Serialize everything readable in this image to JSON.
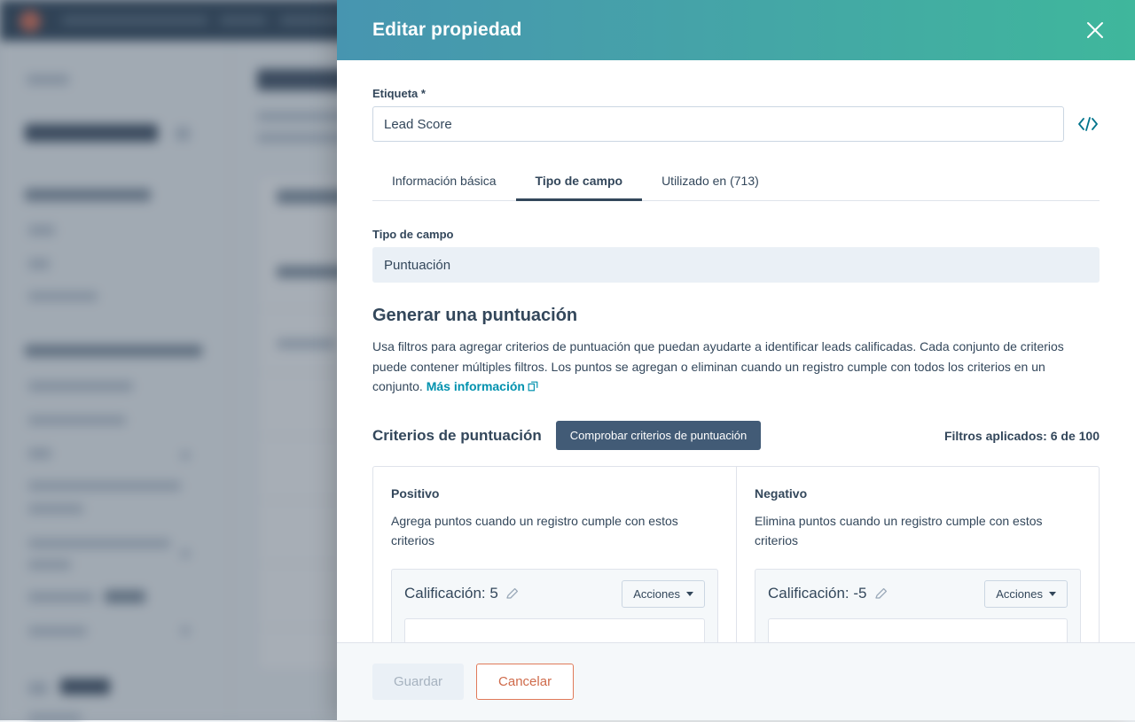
{
  "modal": {
    "title": "Editar propiedad",
    "close_icon": "close-icon",
    "label_field": {
      "label": "Etiqueta *",
      "value": "Lead Score",
      "placeholder": "Etiqueta",
      "code_icon": "code-brackets-icon"
    },
    "tabs": [
      {
        "label": "Información básica",
        "active": false
      },
      {
        "label": "Tipo de campo",
        "active": true
      },
      {
        "label": "Utilizado en (713)",
        "active": false
      }
    ],
    "field_type": {
      "label": "Tipo de campo",
      "value": "Puntuación"
    },
    "score_section": {
      "heading": "Generar una puntuación",
      "description": "Usa filtros para agregar criterios de puntuación que puedan ayudarte a identificar leads calificadas. Cada conjunto de criterios puede contener múltiples filtros. Los puntos se agregan o eliminan cuando un registro cumple con todos los criterios en un conjunto.",
      "link_text": "Más información",
      "link_icon": "external-link-icon"
    },
    "criteria": {
      "heading": "Criterios de puntuación",
      "test_button": "Comprobar criterios de puntuación",
      "filters_applied": "Filtros aplicados: 6 de 100"
    },
    "panels": [
      {
        "title": "Positivo",
        "description": "Agrega puntos cuando un registro cumple con estos criterios",
        "score_label": "Calificación: 5",
        "edit_icon": "pencil-icon",
        "actions_button": "Acciones"
      },
      {
        "title": "Negativo",
        "description": "Elimina puntos cuando un registro cumple con estos criterios",
        "score_label": "Calificación: -5",
        "edit_icon": "pencil-icon",
        "actions_button": "Acciones"
      }
    ],
    "footer": {
      "save_label": "Guardar",
      "cancel_label": "Cancelar"
    }
  },
  "colors": {
    "header_gradient_start": "#4795b0",
    "header_gradient_end": "#3fb79c",
    "accent_link": "#0091ae",
    "dark_button": "#425b76",
    "cancel_border": "#e07a5a",
    "navbar": "#33475b"
  }
}
